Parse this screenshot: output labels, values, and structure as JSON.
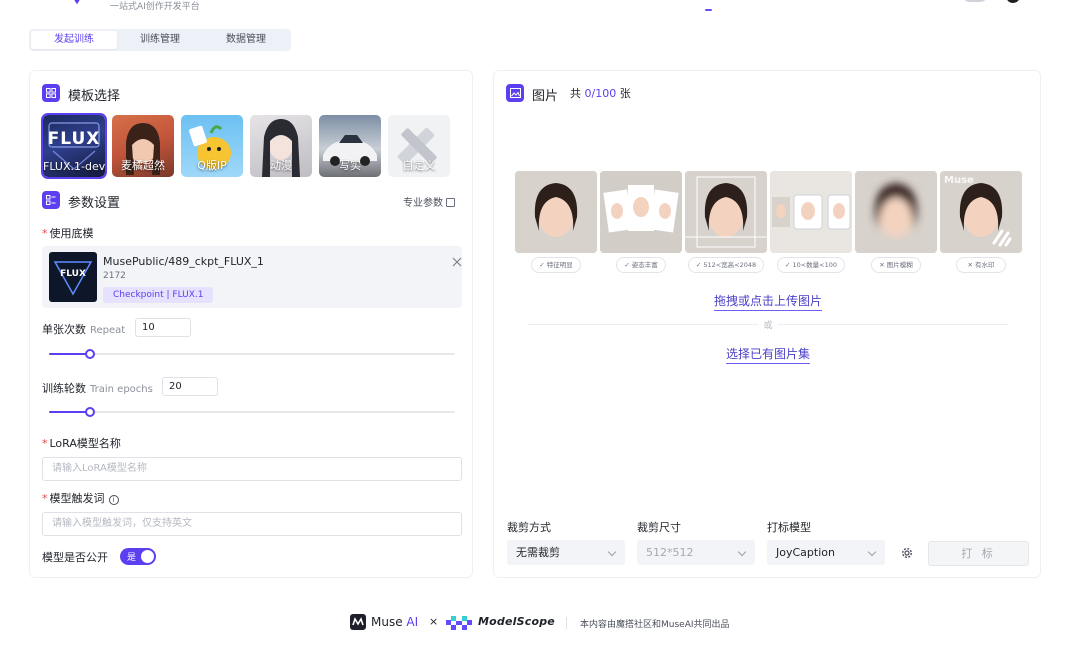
{
  "header": {
    "subtitle": "一站式AI创作开发平台"
  },
  "tabs": [
    {
      "label": "发起训练",
      "active": true
    },
    {
      "label": "训练管理",
      "active": false
    },
    {
      "label": "数据管理",
      "active": false
    }
  ],
  "template_section": {
    "title": "模板选择",
    "flux_logo_text": "FLUX",
    "items": [
      {
        "label": "FLUX.1-dev",
        "selected": true
      },
      {
        "label": "麦橘超然",
        "selected": false
      },
      {
        "label": "Q版IP",
        "selected": false
      },
      {
        "label": "动漫",
        "selected": false
      },
      {
        "label": "写实",
        "selected": false
      },
      {
        "label": "自定义",
        "selected": false
      }
    ]
  },
  "params_section": {
    "title": "参数设置",
    "pro_params": "专业参数"
  },
  "base_model": {
    "label": "使用底模",
    "name": "MusePublic/489_ckpt_FLUX_1",
    "id": "2172",
    "tag": "Checkpoint | FLUX.1",
    "thumb_text": "FLUX"
  },
  "repeat": {
    "label": "单张次数",
    "en": "Repeat",
    "value": "10",
    "fraction": 0.1
  },
  "epochs": {
    "label": "训练轮数",
    "en": "Train epochs",
    "value": "20",
    "fraction": 0.1
  },
  "lora_name": {
    "label": "LoRA模型名称",
    "placeholder": "请输入LoRA模型名称"
  },
  "trigger_word": {
    "label": "模型触发词",
    "placeholder": "请输入模型触发词，仅支持英文"
  },
  "public": {
    "label": "模型是否公开",
    "toggle_text": "是",
    "on": true
  },
  "images_section": {
    "title": "图片",
    "count_prefix": "共 ",
    "count": "0/100",
    "count_suffix": " 张"
  },
  "sample_chips": [
    {
      "label": "特征明显",
      "ok": true
    },
    {
      "label": "姿态丰富",
      "ok": true
    },
    {
      "label": "512<宽高<2048",
      "ok": true
    },
    {
      "label": "10<数量<100",
      "ok": true
    },
    {
      "label": "图片模糊",
      "ok": false
    },
    {
      "label": "有水印",
      "ok": false
    }
  ],
  "watermark_text": "Muse",
  "upload": {
    "drag_label": "拖拽或点击上传图片",
    "or_label": "或",
    "select_label": "选择已有图片集"
  },
  "crop_method": {
    "label": "裁剪方式",
    "value": "无需裁剪"
  },
  "crop_size": {
    "label": "裁剪尺寸",
    "value": "512*512"
  },
  "tag_model": {
    "label": "打标模型",
    "value": "JoyCaption"
  },
  "tag_button": "打 标",
  "footer": {
    "muse": "Muse",
    "ai": " AI",
    "times": "×",
    "modelscope": "ModelScope",
    "note": "本内容由魔搭社区和MuseAI共同出品"
  },
  "colors": {
    "accent": "#5b3ff0",
    "required": "#e5484d",
    "link": "#4a3fc8"
  }
}
